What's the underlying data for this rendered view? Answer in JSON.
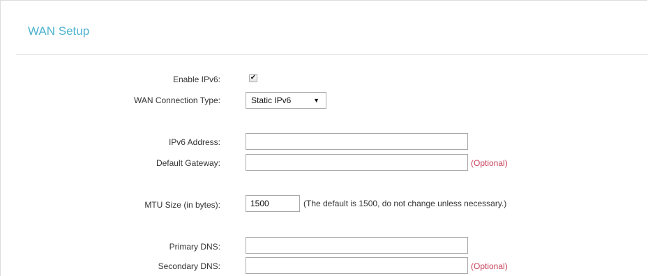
{
  "section": {
    "title": "WAN Setup"
  },
  "form": {
    "enable_ipv6": {
      "label": "Enable IPv6:",
      "checked": true,
      "check_glyph": "✔"
    },
    "connection_type": {
      "label": "WAN Connection Type:",
      "value": "Static IPv6",
      "arrow": "▼"
    },
    "ipv6_address": {
      "label": "IPv6 Address:",
      "value": ""
    },
    "default_gateway": {
      "label": "Default Gateway:",
      "value": "",
      "note": "(Optional)"
    },
    "mtu": {
      "label": "MTU Size (in bytes):",
      "value": "1500",
      "hint": "(The default is 1500, do not change unless necessary.)"
    },
    "primary_dns": {
      "label": "Primary DNS:",
      "value": ""
    },
    "secondary_dns": {
      "label": "Secondary DNS:",
      "value": "",
      "note": "(Optional)"
    }
  },
  "colors": {
    "title": "#4fb3cf",
    "optional": "#c8445c",
    "text": "#333333",
    "border": "#a9a9a9"
  }
}
